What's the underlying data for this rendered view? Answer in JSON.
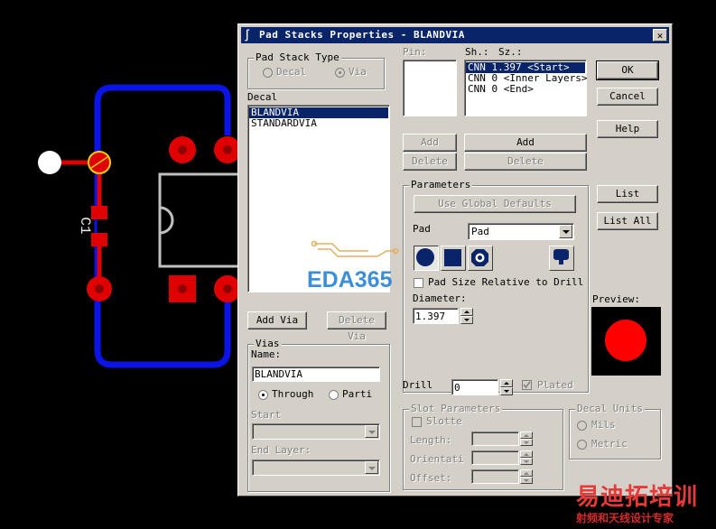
{
  "pcb": {
    "component_ref": "C1",
    "colors": {
      "trace": "#e00000",
      "outline": "#0a14e6",
      "silk": "#c0c0c0",
      "pad": "#e00000",
      "pin1": "#ffffff"
    }
  },
  "watermark": {
    "brand": "EDA365",
    "cn_title": "易迪拓培训",
    "cn_sub": "射频和天线设计专家"
  },
  "dialog": {
    "title": "Pad Stacks Properties - BLANDVIA",
    "close": "✕",
    "pad_stack_type": {
      "legend": "Pad Stack Type",
      "options": [
        "Decal",
        "Via"
      ],
      "selected": "Via"
    },
    "decal": {
      "label": "Decal",
      "items": [
        "BLANDVIA",
        "STANDARDVIA"
      ],
      "selected": "BLANDVIA"
    },
    "pin": {
      "label": "Pin:"
    },
    "sh_label": "Sh.:",
    "sz_label": "Sz.:",
    "stack_items": [
      "CNN 1.397 <Start>",
      "CNN 0 <Inner Layers>",
      "CNN 0 <End>"
    ],
    "stack_selected": "CNN 1.397 <Start>",
    "buttons": {
      "ok": "OK",
      "cancel": "Cancel",
      "help": "Help",
      "add_left": "Add",
      "delete_left": "Delete",
      "add_right": "Add",
      "delete_right": "Delete",
      "list": "List",
      "list_all": "List All",
      "add_via": "Add Via",
      "delete_via": "Delete Via"
    },
    "parameters": {
      "legend": "Parameters",
      "use_global": "Use Global Defaults",
      "pad_label": "Pad",
      "pad_value": "Pad",
      "shapes": [
        "round",
        "square",
        "annular",
        "odd-shape"
      ],
      "pad_size_relative": "Pad Size Relative to Drill",
      "diameter_label": "Diameter:",
      "diameter_value": "1.397"
    },
    "preview_label": "Preview:",
    "vias": {
      "legend": "Vias",
      "name_label": "Name:",
      "name_value": "BLANDVIA",
      "options": [
        "Through",
        "Parti"
      ],
      "selected": "Through",
      "start_label": "Start",
      "end_label": "End Layer:"
    },
    "drill": {
      "label": "Drill",
      "value": "0",
      "plated": "Plated"
    },
    "slot": {
      "legend": "Slot Parameters",
      "slotted": "Slotte",
      "length": "Length:",
      "orientation": "Orientati",
      "offset": "Offset:"
    },
    "units": {
      "legend": "Decal Units",
      "options": [
        "Mils",
        "Metric"
      ],
      "selected": "Metric"
    }
  }
}
